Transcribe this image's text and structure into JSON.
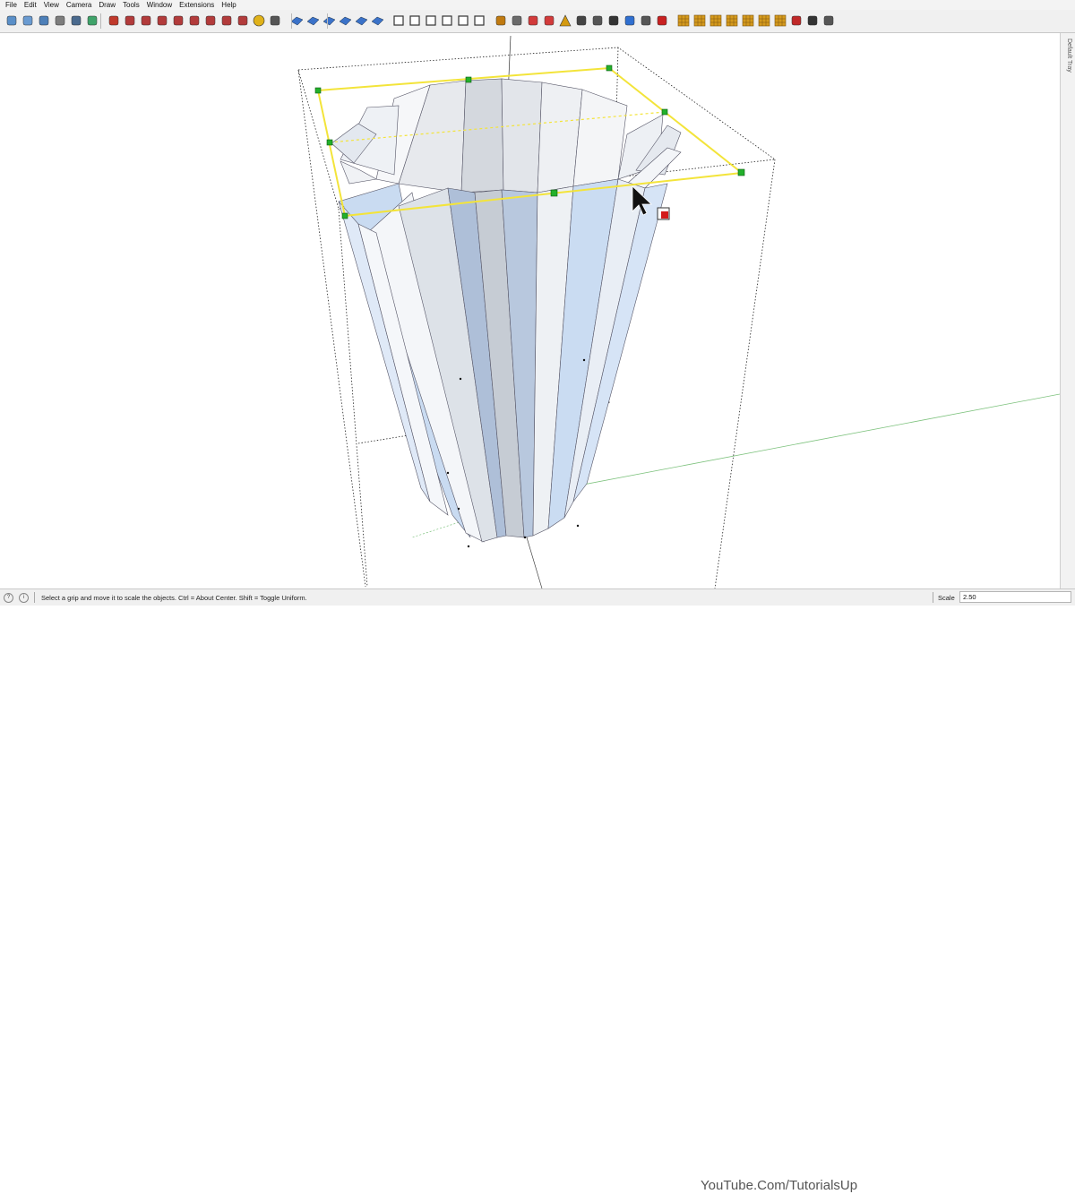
{
  "menu": [
    "File",
    "Edit",
    "View",
    "Camera",
    "Draw",
    "Tools",
    "Window",
    "Extensions",
    "Help"
  ],
  "toolbar": {
    "icons": [
      "iso-view-icon",
      "top-view-icon",
      "front-view-icon",
      "back-view-icon",
      "x-ray-icon",
      "ground-icon",
      "eraser-icon",
      "solid-tools-icon",
      "solid-tools-icon",
      "solid-tools-icon",
      "solid-tools-icon",
      "solid-tools-icon",
      "solid-tools-icon",
      "solid-tools-icon",
      "solid-tools-icon",
      "circle-tool-icon",
      "settings-tools-icon",
      "sandbox-icon",
      "sandbox-icon",
      "sandbox-icon",
      "sandbox-icon",
      "sandbox-icon",
      "sandbox-icon",
      "section-icon",
      "section-icon",
      "section-icon",
      "section-icon",
      "section-icon",
      "section-icon",
      "dimension-icon",
      "protractor-icon",
      "curve-icon",
      "curve-icon",
      "warning-icon",
      "lasso-icon",
      "fillet-icon",
      "rotate-icon",
      "move-icon",
      "cup-icon",
      "magnet-icon",
      "grid-icon",
      "grid-icon",
      "grid-icon",
      "grid-icon",
      "grid-icon",
      "grid-icon",
      "grid-icon",
      "dots-icon",
      "arc-icon",
      "layers-icon"
    ]
  },
  "tray": {
    "label": "Default Tray"
  },
  "status": {
    "message": "Select a grip and move it to scale the objects. Ctrl = About Center. Shift = Toggle Uniform.",
    "watermark": "YouTube.Com/TutorialsUp",
    "vcb_label": "Scale",
    "vcb_value": "2.50"
  },
  "colors": {
    "accent_yellow": "#f3e43a",
    "grip_green": "#22b02b",
    "axis_green": "#7dc27d",
    "axis_blue": "#3a3ad8",
    "model_blue": "#c7dcf5",
    "model_gray": "#d9dce2"
  }
}
